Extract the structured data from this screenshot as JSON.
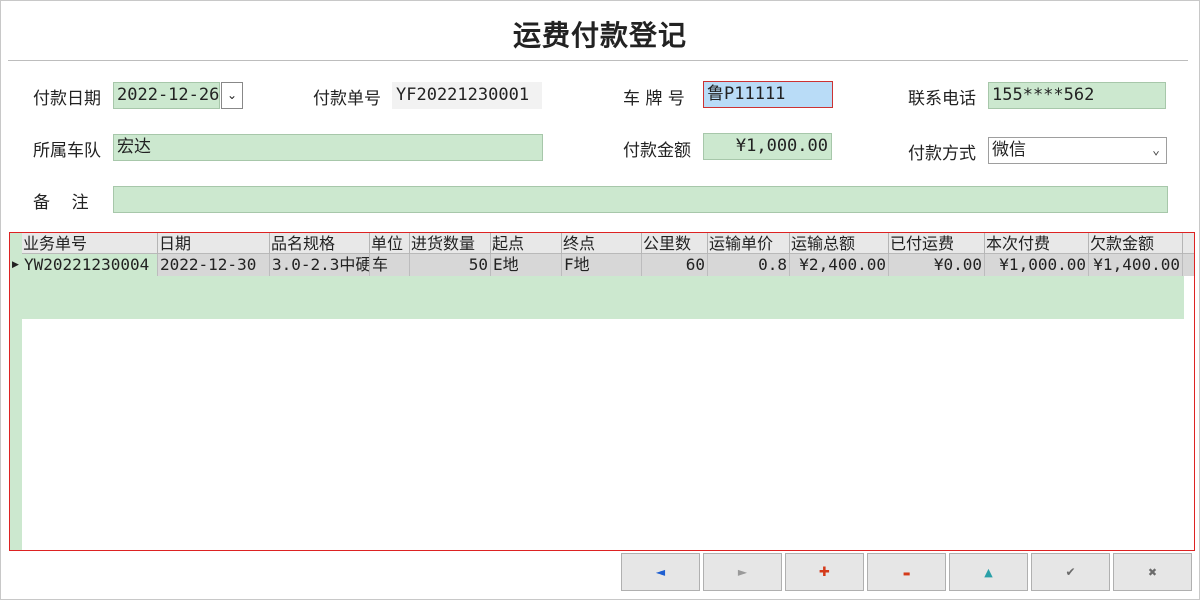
{
  "title": "运费付款登记",
  "form": {
    "pay_date_label": "付款日期",
    "pay_date_value": "2022-12-26",
    "pay_no_label": "付款单号",
    "pay_no_value": "YF20221230001",
    "plate_label": "车 牌 号",
    "plate_value": "鲁P11111",
    "phone_label": "联系电话",
    "phone_value": "155****562",
    "fleet_label": "所属车队",
    "fleet_value": "宏达",
    "amount_label": "付款金额",
    "amount_value": "¥1,000.00",
    "method_label": "付款方式",
    "method_value": "微信",
    "remark_label": "备    注",
    "remark_value": ""
  },
  "grid": {
    "columns": [
      "业务单号",
      "日期",
      "品名规格",
      "单位",
      "进货数量",
      "起点",
      "终点",
      "公里数",
      "运输单价",
      "运输总额",
      "已付运费",
      "本次付费",
      "欠款金额"
    ],
    "rows": [
      [
        "YW20221230004",
        "2022-12-30",
        "3.0-2.3中硬",
        "车",
        "50",
        "E地",
        "F地",
        "60",
        "0.8",
        "¥2,400.00",
        "¥0.00",
        "¥1,000.00",
        "¥1,400.00"
      ]
    ]
  },
  "nav": {
    "prev": "◄",
    "next": "►",
    "add": "✚",
    "remove": "▬",
    "up": "▲",
    "save": "✔",
    "close": "✖"
  },
  "colors": {
    "field_green": "#cce8cf",
    "grid_border": "#dd2222",
    "prev_icon": "#1e5fd1",
    "add_icon": "#d43a1a",
    "remove_icon": "#d43a1a",
    "up_icon": "#2aa0a8"
  }
}
